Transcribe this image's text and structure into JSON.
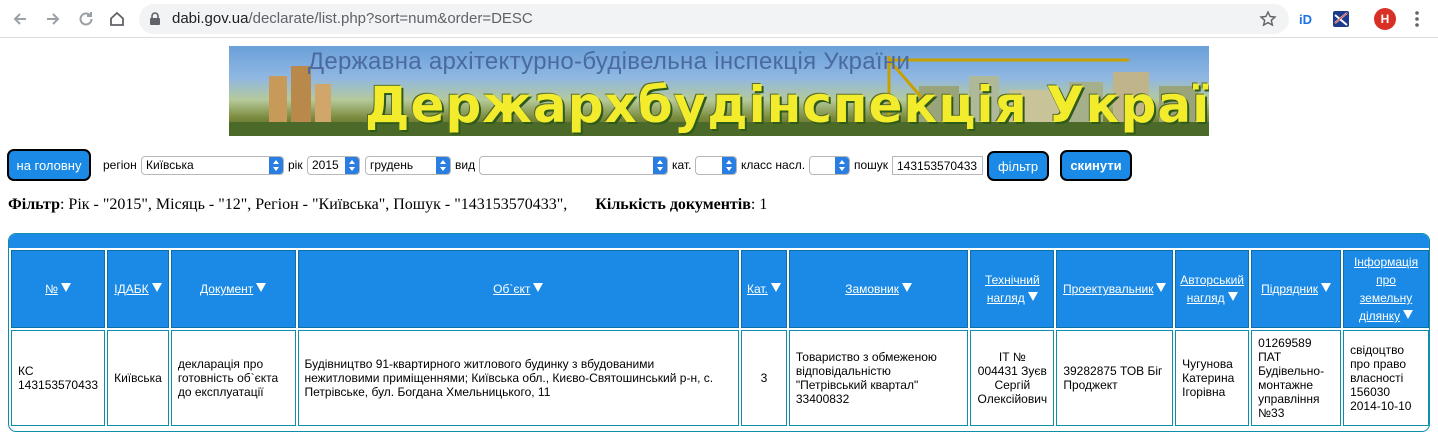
{
  "browser": {
    "url_host": "dabi.gov.ua",
    "url_path": "/declarate/list.php?sort=num&order=DESC",
    "avatar_letter": "H"
  },
  "banner": {
    "subtitle": "Державна архітектурно-будівельна інспекція України",
    "title": "Держархбудінспекція України"
  },
  "filters": {
    "home_button": "на головну",
    "region_label": "регіон",
    "region_value": "Київська",
    "year_label": "рік",
    "year_value": "2015",
    "month_value": "грудень",
    "type_label": "вид",
    "type_value": "",
    "category_label": "кат.",
    "category_value": "",
    "class_label": "класс насл.",
    "class_value": "",
    "search_label": "пошук",
    "search_value": "143153570433",
    "filter_button": "фільтр",
    "reset_button": "скинути"
  },
  "summary": {
    "filter_label": "Фільтр",
    "filter_text": ": Рік - \"2015\", Місяць - \"12\", Регіон - \"Київська\", Пошук - \"143153570433\",",
    "count_label": "Кількість документів",
    "count_value": ": 1"
  },
  "table": {
    "headers": [
      {
        "line1": "№",
        "line2": "",
        "line3": ""
      },
      {
        "line1": "ІДАБК",
        "line2": "",
        "line3": ""
      },
      {
        "line1": "Документ",
        "line2": "",
        "line3": ""
      },
      {
        "line1": "Об`єкт",
        "line2": "",
        "line3": ""
      },
      {
        "line1": "Кат.",
        "line2": "",
        "line3": ""
      },
      {
        "line1": "Замовник",
        "line2": "",
        "line3": ""
      },
      {
        "line1": "Технічний",
        "line2": "нагляд",
        "line3": ""
      },
      {
        "line1": "Проектувальник",
        "line2": "",
        "line3": ""
      },
      {
        "line1": "Авторський",
        "line2": "нагляд",
        "line3": ""
      },
      {
        "line1": "Підрядник",
        "line2": "",
        "line3": ""
      },
      {
        "line1": "Інформація",
        "line2": "про",
        "line3": "земельну",
        "line4": "ділянку"
      }
    ],
    "rows": [
      {
        "num": "КС 143153570433",
        "idabk": "Київська",
        "document": "декларація про готовність об`єкта до експлуатації",
        "object": "Будівництво 91-квартирного житлового будинку з вбудованими нежитловими приміщеннями; Київська обл., Києво-Святошинський р-н, с. Петрівське, бул. Богдана Хмельницького, 11",
        "category": "3",
        "customer": "Товариство з обмеженою відповідальністю \"Петрівський квартал\" 33400832",
        "tech_supervision": "ІТ № 004431 Зуєв Сергій Олексійович",
        "designer": "39282875 ТОВ Біг Проджект",
        "author_supervision": "Чугунова Катерина Ігорівна",
        "contractor": "01269589 ПАТ Будівельно-монтажне управління №33",
        "land_info": "свідоцтво про право власності 156030 2014-10-10"
      }
    ]
  }
}
